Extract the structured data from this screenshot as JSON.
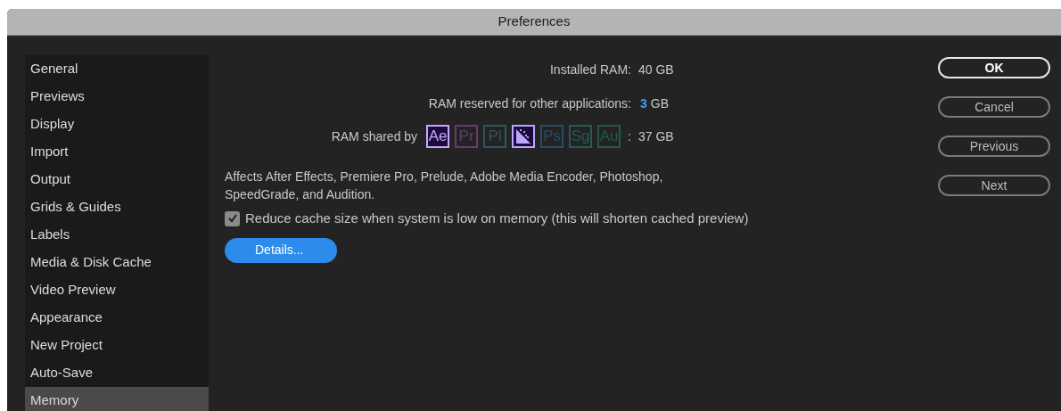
{
  "window": {
    "title": "Preferences"
  },
  "sidebar": {
    "items": [
      {
        "label": "General",
        "selected": false
      },
      {
        "label": "Previews",
        "selected": false
      },
      {
        "label": "Display",
        "selected": false
      },
      {
        "label": "Import",
        "selected": false
      },
      {
        "label": "Output",
        "selected": false
      },
      {
        "label": "Grids & Guides",
        "selected": false
      },
      {
        "label": "Labels",
        "selected": false
      },
      {
        "label": "Media & Disk Cache",
        "selected": false
      },
      {
        "label": "Video Preview",
        "selected": false
      },
      {
        "label": "Appearance",
        "selected": false
      },
      {
        "label": "New Project",
        "selected": false
      },
      {
        "label": "Auto-Save",
        "selected": false
      },
      {
        "label": "Memory",
        "selected": true
      }
    ]
  },
  "memory": {
    "installed_label": "Installed RAM:",
    "installed_value": "40 GB",
    "reserved_label": "RAM reserved for other applications:",
    "reserved_amount": "3",
    "reserved_unit": "GB",
    "shared_label": "RAM shared by",
    "shared_separator": ":",
    "shared_value": "37 GB",
    "apps": [
      {
        "kind": "text",
        "text": "Ae",
        "active": true,
        "color": "#c9a6ff"
      },
      {
        "kind": "text",
        "text": "Pr",
        "active": false,
        "color": "#6a3a6e"
      },
      {
        "kind": "text",
        "text": "Pl",
        "active": false,
        "color": "#2f5560"
      },
      {
        "kind": "encoder",
        "active": true,
        "color": "#b9a6ff"
      },
      {
        "kind": "text",
        "text": "Ps",
        "active": false,
        "color": "#24506a"
      },
      {
        "kind": "text",
        "text": "Sg",
        "active": false,
        "color": "#255a55"
      },
      {
        "kind": "text",
        "text": "Au",
        "active": false,
        "color": "#1f5a4e"
      }
    ],
    "note": "Affects After Effects, Premiere Pro, Prelude, Adobe Media Encoder, Photoshop, SpeedGrade, and Audition.",
    "reduce_cache": {
      "label": "Reduce cache size when system is low on memory (this will shorten cached preview)",
      "checked": true
    },
    "details_button": "Details..."
  },
  "buttons": [
    {
      "label": "OK",
      "default": true
    },
    {
      "label": "Cancel",
      "default": false
    },
    {
      "label": "Previous",
      "default": false
    },
    {
      "label": "Next",
      "default": false
    }
  ]
}
